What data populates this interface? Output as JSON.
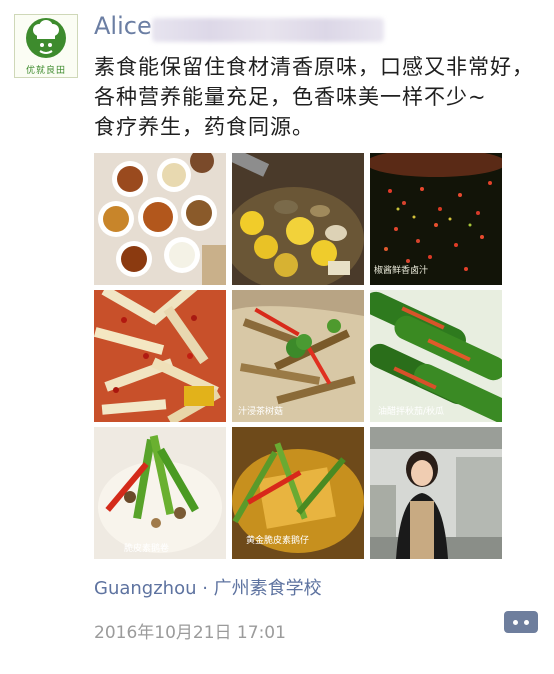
{
  "post": {
    "username": "Alice",
    "avatar_text": "优就良田",
    "lines": [
      "素食能保留住食材清香原味，口感又非常好，",
      "各种营养能量充足，色香味美一样不少~",
      "食疗养生，药食同源。"
    ],
    "location": "Guangzhou · 广州素食学校",
    "timestamp": "2016年10月21日 17:01"
  },
  "photos": [
    {
      "name": "dishes-assortment",
      "caption": ""
    },
    {
      "name": "corn-mushroom-soup",
      "caption": ""
    },
    {
      "name": "pepper-jelly",
      "caption": "椒酱鲜香卤汁"
    },
    {
      "name": "chili-bamboo-shoots",
      "caption": ""
    },
    {
      "name": "mushroom-noodle",
      "caption": "汁浸茶树菇"
    },
    {
      "name": "cucumber-dish",
      "caption": "油醋拌秋茄/秋瓜"
    },
    {
      "name": "rice-noodle",
      "caption": "脆皮素鹅卷"
    },
    {
      "name": "tofu-greens",
      "caption": "黄金脆皮素鹅仔"
    },
    {
      "name": "chef-kitchen",
      "caption": ""
    }
  ],
  "icons": {
    "avatar": "chef-hat-icon",
    "comment": "comment-dots-icon"
  }
}
